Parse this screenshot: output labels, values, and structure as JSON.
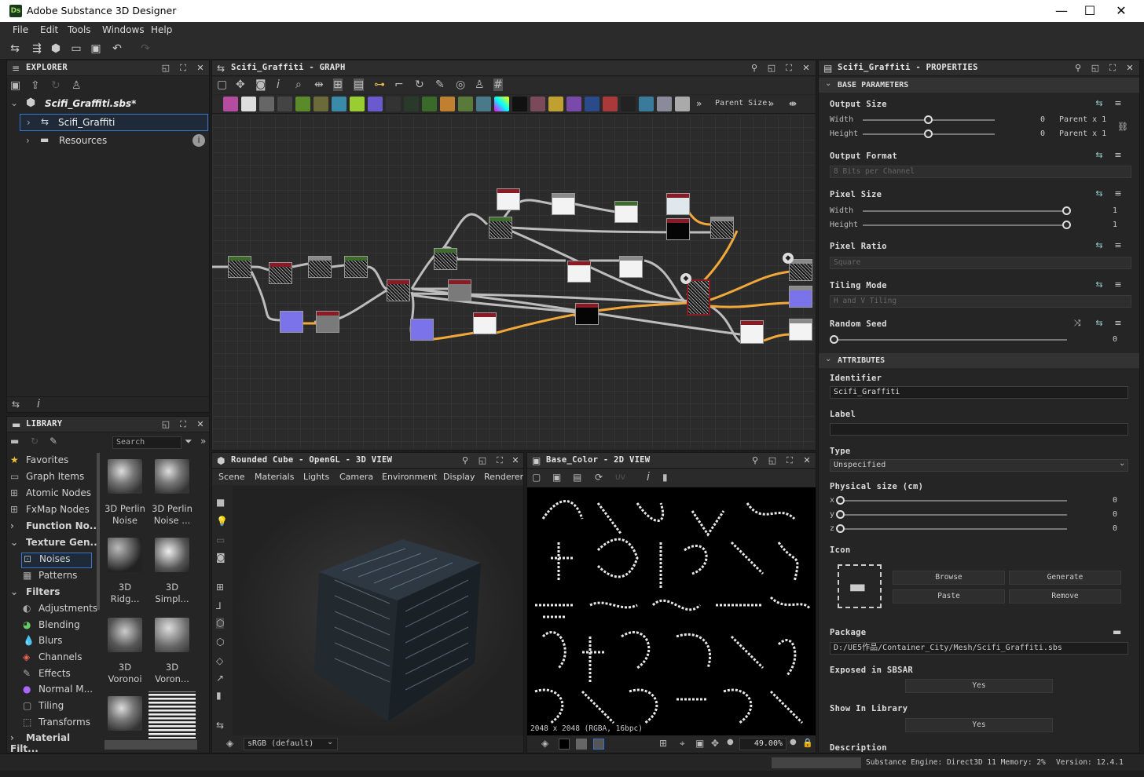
{
  "window": {
    "title": "Adobe Substance 3D Designer",
    "logo": "Ds"
  },
  "menu": [
    "File",
    "Edit",
    "Tools",
    "Windows",
    "Help"
  ],
  "explorer": {
    "title": "EXPLORER",
    "package": "Scifi_Graffiti.sbs*",
    "graph": "Scifi_Graffiti",
    "resources": "Resources"
  },
  "graph": {
    "title": "Scifi_Graffiti - GRAPH",
    "parent_size_label": "Parent Size:"
  },
  "library": {
    "title": "LIBRARY",
    "search_placeholder": "Search",
    "items": [
      "Favorites",
      "Graph Items",
      "Atomic Nodes",
      "FxMap Nodes",
      "Function No...",
      "Texture Gen...",
      "Noises",
      "Patterns",
      "Filters",
      "Adjustments",
      "Blending",
      "Blurs",
      "Channels",
      "Effects",
      "Normal M...",
      "Tiling",
      "Transforms",
      "Material Filt..."
    ],
    "thumbs": [
      {
        "l1": "3D Perlin",
        "l2": "Noise"
      },
      {
        "l1": "3D Perlin",
        "l2": "Noise ..."
      },
      {
        "l1": "3D",
        "l2": "Ridg..."
      },
      {
        "l1": "3D",
        "l2": "Simpl..."
      },
      {
        "l1": "3D",
        "l2": "Voronoi"
      },
      {
        "l1": "3D",
        "l2": "Voron..."
      }
    ]
  },
  "view3d": {
    "title": "Rounded Cube - OpenGL - 3D VIEW",
    "tabs": [
      "Scene",
      "Materials",
      "Lights",
      "Camera",
      "Environment",
      "Display",
      "Renderer"
    ],
    "colorspace": "sRGB (default)"
  },
  "view2d": {
    "title": "Base_Color - 2D VIEW",
    "uv": "UV",
    "info": "2048 x 2048 (RGBA, 16bpc)",
    "zoom": "49.00%"
  },
  "properties": {
    "title": "Scifi_Graffiti - PROPERTIES",
    "base_section": "BASE PARAMETERS",
    "output_size": {
      "label": "Output Size",
      "width_label": "Width",
      "height_label": "Height",
      "width_val": "0",
      "height_val": "0",
      "width_suffix": "Parent x 1",
      "height_suffix": "Parent x 1"
    },
    "output_format": {
      "label": "Output Format",
      "value": "8 Bits per Channel"
    },
    "pixel_size": {
      "label": "Pixel Size",
      "width_label": "Width",
      "height_label": "Height",
      "width_val": "1",
      "height_val": "1"
    },
    "pixel_ratio": {
      "label": "Pixel Ratio",
      "value": "Square"
    },
    "tiling_mode": {
      "label": "Tiling Mode",
      "value": "H and V Tiling"
    },
    "random_seed": {
      "label": "Random Seed",
      "value": "0"
    },
    "attr_section": "ATTRIBUTES",
    "identifier": {
      "label": "Identifier",
      "value": "Scifi_Graffiti"
    },
    "label": {
      "label": "Label",
      "value": ""
    },
    "type": {
      "label": "Type",
      "value": "Unspecified"
    },
    "physical_size": {
      "label": "Physical size (cm)",
      "x": "0",
      "y": "0",
      "z": "0"
    },
    "icon": {
      "label": "Icon",
      "browse": "Browse",
      "generate": "Generate",
      "paste": "Paste",
      "remove": "Remove"
    },
    "package": {
      "label": "Package",
      "value": "D:/UE5作品/Container_City/Mesh/Scifi_Graffiti.sbs"
    },
    "exposed": {
      "label": "Exposed in SBSAR",
      "value": "Yes"
    },
    "show_lib": {
      "label": "Show In Library",
      "value": "Yes"
    },
    "description": {
      "label": "Description"
    }
  },
  "status": {
    "engine": "Substance Engine: Direct3D 11 Memory: 2%",
    "version": "Version: 12.4.1"
  },
  "colors": {
    "accent": "#f0a83a",
    "node_red": "#8a1b25",
    "node_green": "#3d6b2c"
  }
}
